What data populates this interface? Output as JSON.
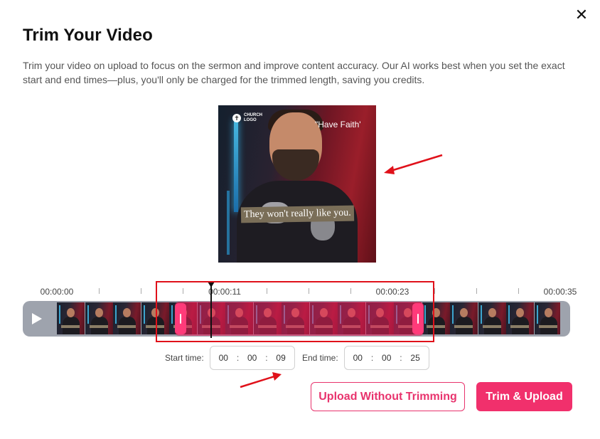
{
  "modal": {
    "title": "Trim Your Video",
    "description": "Trim your video on upload to focus on the sermon and improve content accuracy. Our AI works best when you set the exact start and end times—plus, you'll only be charged for the trimmed length, saving you credits.",
    "close_icon": "close-icon",
    "close_glyph": "✕"
  },
  "preview": {
    "logo_text": "CHURCH LOGO",
    "logo_glyph": "✝",
    "quote": "\"Have Faith'",
    "caption": "They won't really like you."
  },
  "timeline": {
    "tick_labels": [
      "00:00:00",
      "00:00:11",
      "00:00:23",
      "00:00:35"
    ],
    "frame_count": 18,
    "duration_seconds": 35,
    "selection_start_seconds": 9,
    "selection_end_seconds": 25,
    "playhead_seconds": 11
  },
  "start_time": {
    "label": "Start time:",
    "hh": "00",
    "mm": "00",
    "ss": "09"
  },
  "end_time": {
    "label": "End time:",
    "hh": "00",
    "mm": "00",
    "ss": "25"
  },
  "actions": {
    "upload_without_trimming": "Upload Without Trimming",
    "trim_and_upload": "Trim & Upload"
  },
  "colors": {
    "accent": "#f1306c",
    "annotation_red": "#e0111a",
    "timeline_bg": "#9ea3ad"
  }
}
